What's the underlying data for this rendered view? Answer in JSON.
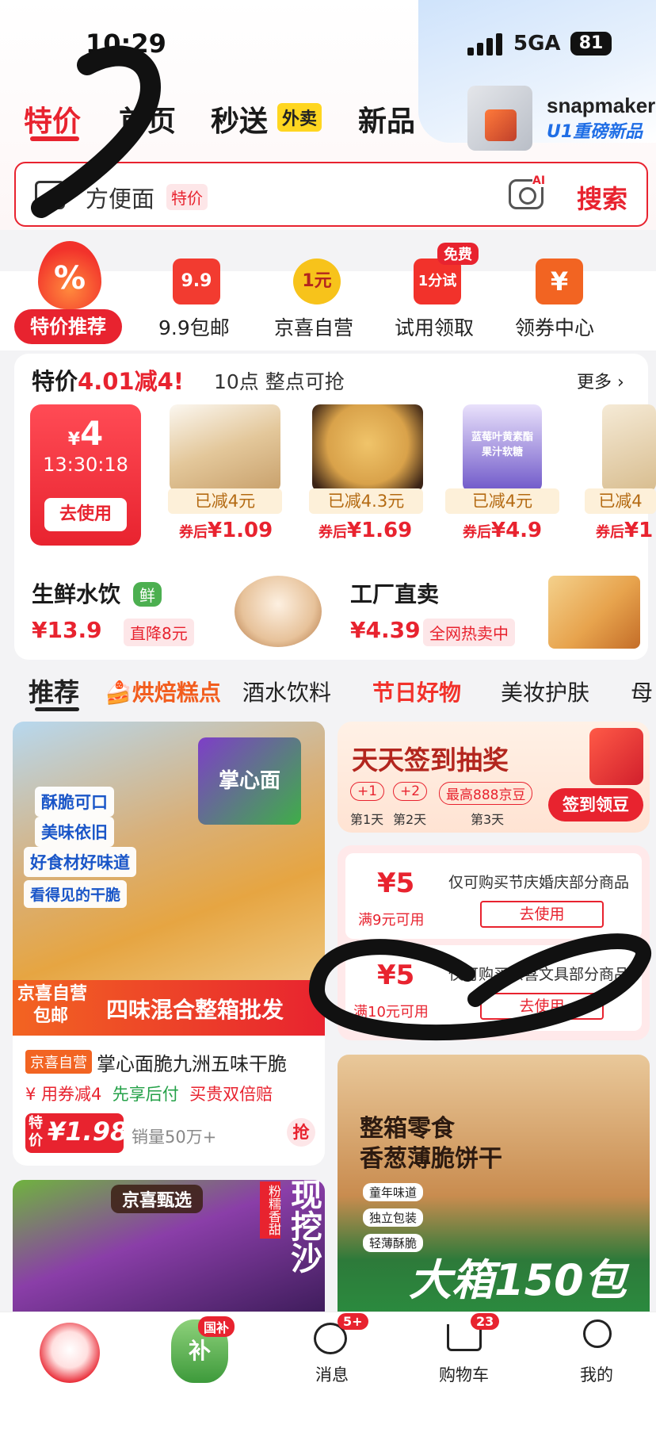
{
  "status_bar": {
    "time": "10:29",
    "network": "5GA",
    "battery": "81"
  },
  "ad_banner": {
    "brand": "snapmaker",
    "tagline": "U1重磅新品"
  },
  "nav_tabs": [
    {
      "label": "特价"
    },
    {
      "label": "首页"
    },
    {
      "label": "秒送"
    },
    {
      "label": "新品"
    }
  ],
  "waimai_badge": "外卖",
  "search": {
    "query": "方便面",
    "tag": "特价",
    "ai_mark": "AI",
    "button": "搜索"
  },
  "channels": {
    "hot_label": "特价推荐",
    "hot_symbol": "%",
    "items": [
      {
        "label": "9.9包邮",
        "icon_text": "9.9",
        "color": "#f23b30"
      },
      {
        "label": "京喜自营",
        "icon_text": "1元",
        "color": "#f7c31b"
      },
      {
        "label": "试用领取",
        "icon_text": "1分试",
        "color": "#f2322b"
      },
      {
        "label": "领券中心",
        "icon_text": "¥",
        "color": "#f26422"
      }
    ],
    "free_badge": "免费"
  },
  "flash": {
    "title_prefix": "特价",
    "title_red": "4.01减4",
    "title_mark": "!",
    "subtitle": "10点 整点可抢",
    "more": "更多",
    "coupon": {
      "currency": "¥",
      "amount": "4",
      "timer": "13:30:18",
      "button": "去使用"
    },
    "products": [
      {
        "saved": "已减4元",
        "after_label": "券后",
        "price": "¥1.09"
      },
      {
        "saved": "已减4.3元",
        "after_label": "券后",
        "price": "¥1.69"
      },
      {
        "saved": "已减4元",
        "after_label": "券后",
        "price": "¥4.9"
      },
      {
        "saved": "已减4",
        "after_label": "券后",
        "price": "¥1"
      }
    ],
    "product_label": "蓝莓叶黄素酯果汁软糖"
  },
  "sections": [
    {
      "title": "生鲜水饮",
      "badge": "鲜",
      "price": "¥13.9",
      "tag": "直降8元"
    },
    {
      "title": "工厂直卖",
      "price": "¥4.39",
      "tag": "全网热卖中"
    }
  ],
  "category_tabs": [
    "推荐",
    "烘焙糕点",
    "酒水饮料",
    "节日好物",
    "美妆护肤",
    "母"
  ],
  "feed": {
    "left_item": {
      "badges": [
        "酥脆可口",
        "美味依旧",
        "好食材好味道",
        "看得见的干脆"
      ],
      "product_name_on_pack": "掌心面",
      "banner_left": [
        "京喜自营",
        "包邮"
      ],
      "banner_right": "四味混合整箱批发",
      "store_tag": "京喜自营",
      "title": "掌心面脆九洲五味干脆",
      "promo_coupon": "用券减4",
      "promo_1": "先享后付",
      "promo_2": "买贵双倍赔",
      "price_label_1": "特",
      "price_label_2": "价",
      "price": "¥1.98",
      "sales": "销量50万+",
      "grab": "抢"
    },
    "left_item_2": {
      "badge": "京喜甄选",
      "side_tag": "粉糯香甜",
      "big_text": "现挖沙"
    },
    "signin": {
      "title": "天天签到抽奖",
      "steps": [
        {
          "value": "+1",
          "day": "第1天"
        },
        {
          "value": "+2",
          "day": "第2天"
        },
        {
          "value": "最高888京豆",
          "day": "第3天"
        }
      ],
      "button": "签到领豆"
    },
    "coupons": [
      {
        "amount": "¥5",
        "condition": "满9元可用",
        "desc": "仅可购买节庆婚庆部分商品",
        "button": "去使用"
      },
      {
        "amount": "¥5",
        "condition": "满10元可用",
        "desc": "仅可购买京喜文具部分商品",
        "button": "去使用"
      }
    ],
    "snack": {
      "title_1": "整箱零食",
      "title_2": "香葱薄脆饼干",
      "points": [
        "童年味道",
        "独立包装",
        "轻薄酥脆"
      ],
      "banner": "大箱150包"
    }
  },
  "bottom_nav": {
    "items": [
      {
        "label": ""
      },
      {
        "label": "",
        "badge": "国补",
        "icon_text": "补"
      },
      {
        "label": "消息",
        "badge": "5+"
      },
      {
        "label": "购物车",
        "badge": "23"
      },
      {
        "label": "我的"
      }
    ]
  }
}
